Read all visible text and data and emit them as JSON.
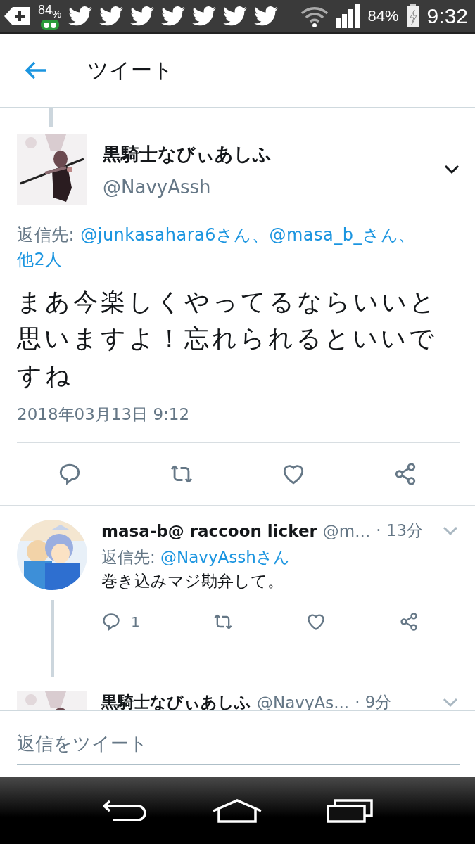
{
  "status_bar": {
    "notification_badge": "84$_{%}$",
    "notifications": [
      {
        "kind": "twitter"
      },
      {
        "kind": "twitter"
      },
      {
        "kind": "twitter"
      },
      {
        "kind": "twitter"
      },
      {
        "kind": "twitter"
      },
      {
        "kind": "twitter"
      },
      {
        "kind": "twitter"
      }
    ],
    "battery": "84%",
    "time": "9:32"
  },
  "header": {
    "title": "ツイート"
  },
  "main_tweet": {
    "name": "黒騎士なびぃあしふ",
    "handle": "@NavyAssh",
    "reply_label": "返信先:",
    "mentions": [
      "@junkasahara6さん、",
      "@masa_b_さん、",
      "他2人"
    ],
    "text": "まあ今楽しくやってるならいいと思いますよ！忘れられるといいですね",
    "date": "2018年03月13日 9:12"
  },
  "replies": [
    {
      "name": "masa-b@ raccoon licker",
      "handle": "@m...",
      "time": "· 13分",
      "reply_label": "返信先:",
      "reply_to": "@NavyAsshさん",
      "text": "巻き込みマジ勘弁して。",
      "reply_count": "1",
      "avatar": {
        "kind": "round"
      },
      "thread_line": true
    },
    {
      "name": "黒騎士なびぃあしふ",
      "handle": "@NavyAs...",
      "time": "· 9分",
      "avatar": {
        "kind": "square"
      },
      "thread_line": false
    }
  ],
  "compose": {
    "placeholder": "返信をツイート"
  }
}
